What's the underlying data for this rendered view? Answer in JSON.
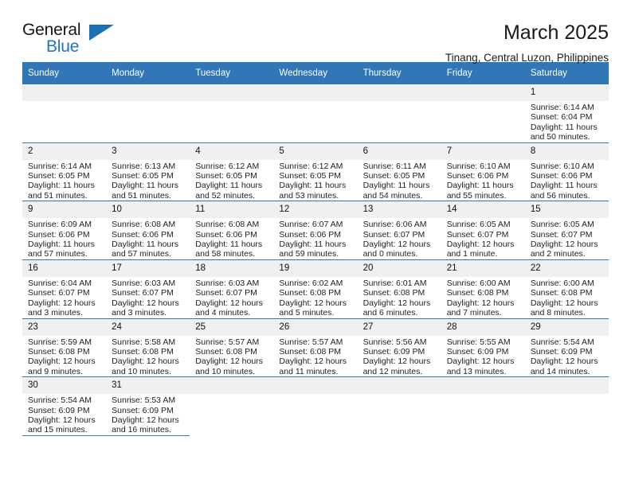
{
  "brand": {
    "name_top": "General",
    "name_bottom": "Blue",
    "accent_color": "#1a70b4"
  },
  "header": {
    "title": "March 2025",
    "subtitle": "Tinang, Central Luzon, Philippines"
  },
  "theme": {
    "header_blue": "#3176b7",
    "daynum_band": "#f0f0f0"
  },
  "weekday_headers": [
    "Sunday",
    "Monday",
    "Tuesday",
    "Wednesday",
    "Thursday",
    "Friday",
    "Saturday"
  ],
  "labels": {
    "sunrise": "Sunrise:",
    "sunset": "Sunset:",
    "daylight": "Daylight:"
  },
  "weeks": [
    [
      {
        "day": "",
        "empty": true
      },
      {
        "day": "",
        "empty": true
      },
      {
        "day": "",
        "empty": true
      },
      {
        "day": "",
        "empty": true
      },
      {
        "day": "",
        "empty": true
      },
      {
        "day": "",
        "empty": true
      },
      {
        "day": "1",
        "sunrise": "Sunrise: 6:14 AM",
        "sunset": "Sunset: 6:04 PM",
        "daylight": "Daylight: 11 hours and 50 minutes."
      }
    ],
    [
      {
        "day": "2",
        "sunrise": "Sunrise: 6:14 AM",
        "sunset": "Sunset: 6:05 PM",
        "daylight": "Daylight: 11 hours and 51 minutes."
      },
      {
        "day": "3",
        "sunrise": "Sunrise: 6:13 AM",
        "sunset": "Sunset: 6:05 PM",
        "daylight": "Daylight: 11 hours and 51 minutes."
      },
      {
        "day": "4",
        "sunrise": "Sunrise: 6:12 AM",
        "sunset": "Sunset: 6:05 PM",
        "daylight": "Daylight: 11 hours and 52 minutes."
      },
      {
        "day": "5",
        "sunrise": "Sunrise: 6:12 AM",
        "sunset": "Sunset: 6:05 PM",
        "daylight": "Daylight: 11 hours and 53 minutes."
      },
      {
        "day": "6",
        "sunrise": "Sunrise: 6:11 AM",
        "sunset": "Sunset: 6:05 PM",
        "daylight": "Daylight: 11 hours and 54 minutes."
      },
      {
        "day": "7",
        "sunrise": "Sunrise: 6:10 AM",
        "sunset": "Sunset: 6:06 PM",
        "daylight": "Daylight: 11 hours and 55 minutes."
      },
      {
        "day": "8",
        "sunrise": "Sunrise: 6:10 AM",
        "sunset": "Sunset: 6:06 PM",
        "daylight": "Daylight: 11 hours and 56 minutes."
      }
    ],
    [
      {
        "day": "9",
        "sunrise": "Sunrise: 6:09 AM",
        "sunset": "Sunset: 6:06 PM",
        "daylight": "Daylight: 11 hours and 57 minutes."
      },
      {
        "day": "10",
        "sunrise": "Sunrise: 6:08 AM",
        "sunset": "Sunset: 6:06 PM",
        "daylight": "Daylight: 11 hours and 57 minutes."
      },
      {
        "day": "11",
        "sunrise": "Sunrise: 6:08 AM",
        "sunset": "Sunset: 6:06 PM",
        "daylight": "Daylight: 11 hours and 58 minutes."
      },
      {
        "day": "12",
        "sunrise": "Sunrise: 6:07 AM",
        "sunset": "Sunset: 6:06 PM",
        "daylight": "Daylight: 11 hours and 59 minutes."
      },
      {
        "day": "13",
        "sunrise": "Sunrise: 6:06 AM",
        "sunset": "Sunset: 6:07 PM",
        "daylight": "Daylight: 12 hours and 0 minutes."
      },
      {
        "day": "14",
        "sunrise": "Sunrise: 6:05 AM",
        "sunset": "Sunset: 6:07 PM",
        "daylight": "Daylight: 12 hours and 1 minute."
      },
      {
        "day": "15",
        "sunrise": "Sunrise: 6:05 AM",
        "sunset": "Sunset: 6:07 PM",
        "daylight": "Daylight: 12 hours and 2 minutes."
      }
    ],
    [
      {
        "day": "16",
        "sunrise": "Sunrise: 6:04 AM",
        "sunset": "Sunset: 6:07 PM",
        "daylight": "Daylight: 12 hours and 3 minutes."
      },
      {
        "day": "17",
        "sunrise": "Sunrise: 6:03 AM",
        "sunset": "Sunset: 6:07 PM",
        "daylight": "Daylight: 12 hours and 3 minutes."
      },
      {
        "day": "18",
        "sunrise": "Sunrise: 6:03 AM",
        "sunset": "Sunset: 6:07 PM",
        "daylight": "Daylight: 12 hours and 4 minutes."
      },
      {
        "day": "19",
        "sunrise": "Sunrise: 6:02 AM",
        "sunset": "Sunset: 6:08 PM",
        "daylight": "Daylight: 12 hours and 5 minutes."
      },
      {
        "day": "20",
        "sunrise": "Sunrise: 6:01 AM",
        "sunset": "Sunset: 6:08 PM",
        "daylight": "Daylight: 12 hours and 6 minutes."
      },
      {
        "day": "21",
        "sunrise": "Sunrise: 6:00 AM",
        "sunset": "Sunset: 6:08 PM",
        "daylight": "Daylight: 12 hours and 7 minutes."
      },
      {
        "day": "22",
        "sunrise": "Sunrise: 6:00 AM",
        "sunset": "Sunset: 6:08 PM",
        "daylight": "Daylight: 12 hours and 8 minutes."
      }
    ],
    [
      {
        "day": "23",
        "sunrise": "Sunrise: 5:59 AM",
        "sunset": "Sunset: 6:08 PM",
        "daylight": "Daylight: 12 hours and 9 minutes."
      },
      {
        "day": "24",
        "sunrise": "Sunrise: 5:58 AM",
        "sunset": "Sunset: 6:08 PM",
        "daylight": "Daylight: 12 hours and 10 minutes."
      },
      {
        "day": "25",
        "sunrise": "Sunrise: 5:57 AM",
        "sunset": "Sunset: 6:08 PM",
        "daylight": "Daylight: 12 hours and 10 minutes."
      },
      {
        "day": "26",
        "sunrise": "Sunrise: 5:57 AM",
        "sunset": "Sunset: 6:08 PM",
        "daylight": "Daylight: 12 hours and 11 minutes."
      },
      {
        "day": "27",
        "sunrise": "Sunrise: 5:56 AM",
        "sunset": "Sunset: 6:09 PM",
        "daylight": "Daylight: 12 hours and 12 minutes."
      },
      {
        "day": "28",
        "sunrise": "Sunrise: 5:55 AM",
        "sunset": "Sunset: 6:09 PM",
        "daylight": "Daylight: 12 hours and 13 minutes."
      },
      {
        "day": "29",
        "sunrise": "Sunrise: 5:54 AM",
        "sunset": "Sunset: 6:09 PM",
        "daylight": "Daylight: 12 hours and 14 minutes."
      }
    ],
    [
      {
        "day": "30",
        "sunrise": "Sunrise: 5:54 AM",
        "sunset": "Sunset: 6:09 PM",
        "daylight": "Daylight: 12 hours and 15 minutes."
      },
      {
        "day": "31",
        "sunrise": "Sunrise: 5:53 AM",
        "sunset": "Sunset: 6:09 PM",
        "daylight": "Daylight: 12 hours and 16 minutes."
      },
      {
        "day": "",
        "empty": true
      },
      {
        "day": "",
        "empty": true
      },
      {
        "day": "",
        "empty": true
      },
      {
        "day": "",
        "empty": true
      },
      {
        "day": "",
        "empty": true
      }
    ]
  ]
}
